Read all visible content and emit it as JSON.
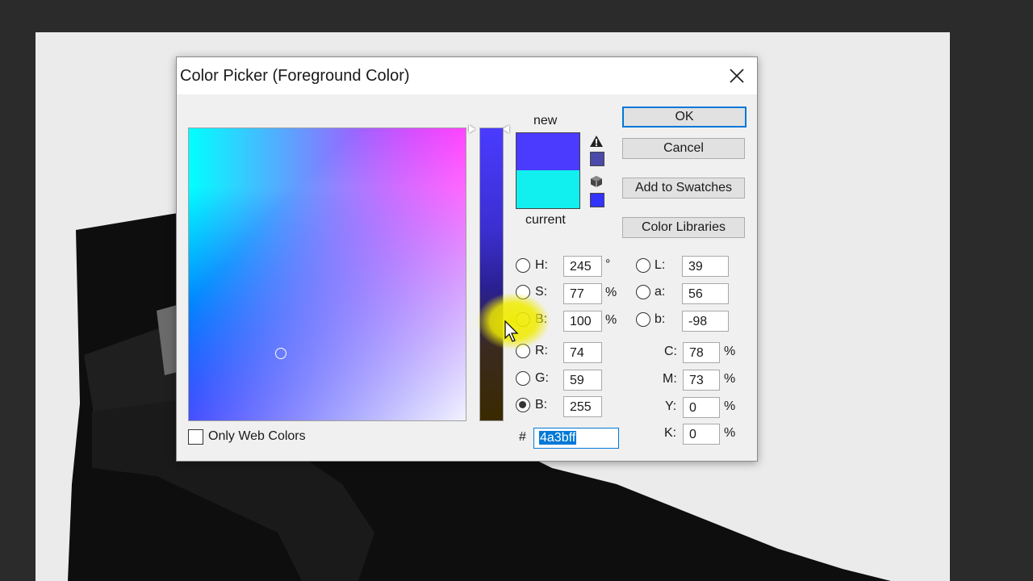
{
  "dialog": {
    "title": "Color Picker (Foreground Color)",
    "only_web_colors": "Only Web Colors",
    "new_label": "new",
    "current_label": "current",
    "new_color": "#4a3bff",
    "current_color": "#12efef",
    "buttons": {
      "ok": "OK",
      "cancel": "Cancel",
      "add_swatches": "Add to Swatches",
      "color_libraries": "Color Libraries"
    },
    "hsb": {
      "h_label": "H:",
      "h": "245",
      "h_unit": "°",
      "s_label": "S:",
      "s": "77",
      "s_unit": "%",
      "b_label": "B:",
      "b": "100",
      "b_unit": "%"
    },
    "rgb": {
      "r_label": "R:",
      "r": "74",
      "g_label": "G:",
      "g": "59",
      "b_label": "B:",
      "b": "255"
    },
    "lab": {
      "l_label": "L:",
      "l": "39",
      "a_label": "a:",
      "a": "56",
      "b_label": "b:",
      "b": "-98"
    },
    "cmyk": {
      "c_label": "C:",
      "c": "78",
      "m_label": "M:",
      "m": "73",
      "y_label": "Y:",
      "y": "0",
      "k_label": "K:",
      "k": "0",
      "unit": "%"
    },
    "hex_label": "#",
    "hex": "4a3bff",
    "selected_channel": "B (RGB)"
  },
  "icons": {
    "close": "close-icon",
    "warning": "out-of-gamut-warning-icon",
    "cube": "web-safe-cube-icon"
  }
}
